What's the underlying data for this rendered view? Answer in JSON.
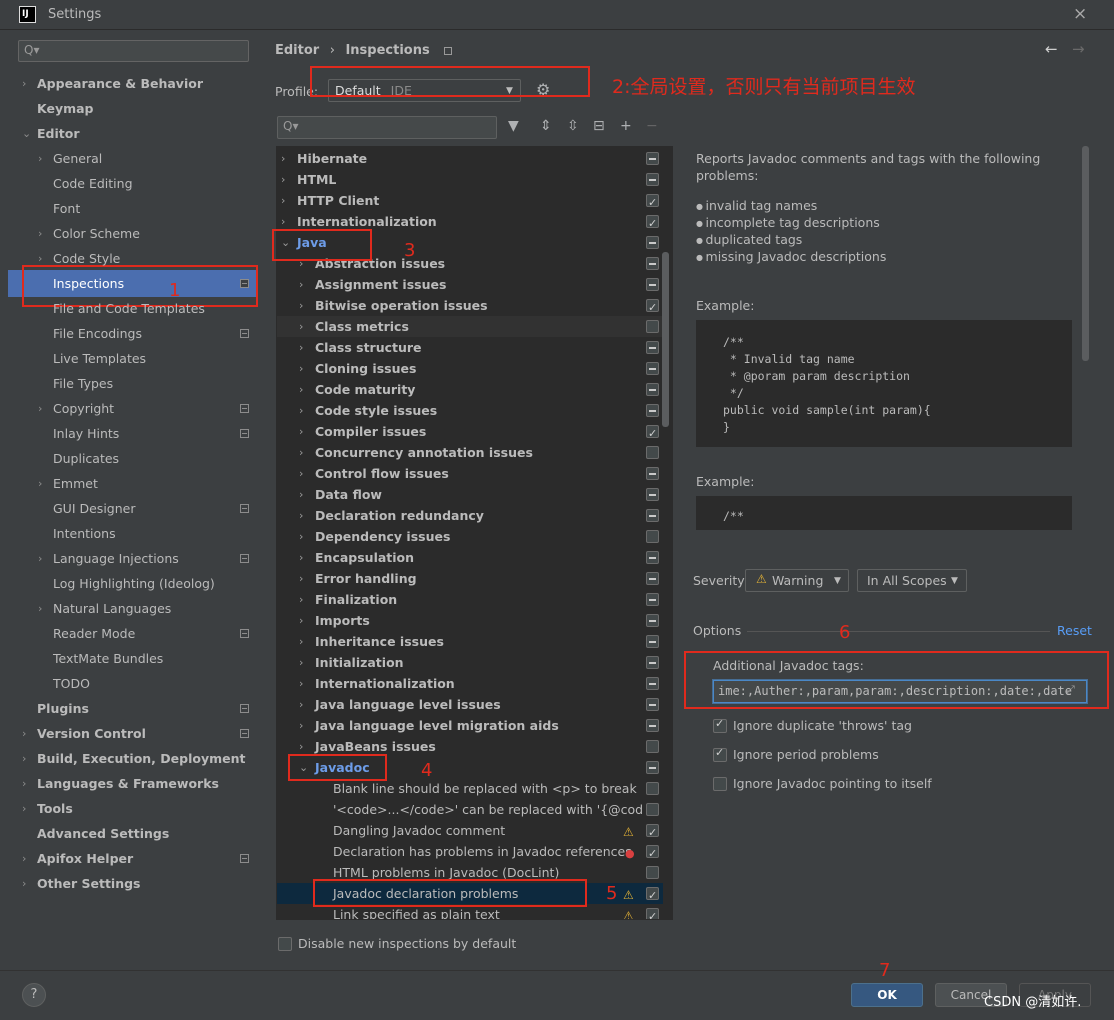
{
  "window": {
    "logo": "IJ",
    "title": "Settings",
    "close_icon": "×"
  },
  "sidebar": {
    "search_placeholder": "Q▾",
    "items": [
      {
        "label": "Appearance & Behavior",
        "bold": true,
        "arrow": "›"
      },
      {
        "label": "Keymap",
        "bold": true
      },
      {
        "label": "Editor",
        "bold": true,
        "arrow": "⌄"
      },
      {
        "label": "General",
        "arrow": "›"
      },
      {
        "label": "Code Editing"
      },
      {
        "label": "Font"
      },
      {
        "label": "Color Scheme",
        "arrow": "›"
      },
      {
        "label": "Code Style",
        "arrow": "›"
      },
      {
        "label": "Inspections",
        "selected": true,
        "square": true
      },
      {
        "label": "File and Code Templates"
      },
      {
        "label": "File Encodings",
        "square": true
      },
      {
        "label": "Live Templates"
      },
      {
        "label": "File Types"
      },
      {
        "label": "Copyright",
        "arrow": "›",
        "square": true
      },
      {
        "label": "Inlay Hints",
        "square": true
      },
      {
        "label": "Duplicates"
      },
      {
        "label": "Emmet",
        "arrow": "›"
      },
      {
        "label": "GUI Designer",
        "square": true
      },
      {
        "label": "Intentions"
      },
      {
        "label": "Language Injections",
        "arrow": "›",
        "square": true
      },
      {
        "label": "Log Highlighting (Ideolog)"
      },
      {
        "label": "Natural Languages",
        "arrow": "›"
      },
      {
        "label": "Reader Mode",
        "square": true
      },
      {
        "label": "TextMate Bundles"
      },
      {
        "label": "TODO"
      },
      {
        "label": "Plugins",
        "bold": true,
        "square": true
      },
      {
        "label": "Version Control",
        "bold": true,
        "arrow": "›",
        "square": true
      },
      {
        "label": "Build, Execution, Deployment",
        "bold": true,
        "arrow": "›"
      },
      {
        "label": "Languages & Frameworks",
        "bold": true,
        "arrow": "›"
      },
      {
        "label": "Tools",
        "bold": true,
        "arrow": "›"
      },
      {
        "label": "Advanced Settings",
        "bold": true
      },
      {
        "label": "Apifox Helper",
        "bold": true,
        "arrow": "›",
        "square": true
      },
      {
        "label": "Other Settings",
        "bold": true,
        "arrow": "›"
      }
    ]
  },
  "header": {
    "breadcrumb_editor": "Editor",
    "breadcrumb_sep": "›",
    "breadcrumb_page": "Inspections",
    "back_icon": "←",
    "forward_icon": "→"
  },
  "profile": {
    "label": "Profile:",
    "value": "Default",
    "scope": "IDE"
  },
  "toolbar": {
    "filter_placeholder": "Q▾"
  },
  "tree": [
    {
      "label": "Hibernate",
      "style": "b",
      "arrow": "›",
      "cb": "partial"
    },
    {
      "label": "HTML",
      "style": "b",
      "arrow": "›",
      "cb": "partial"
    },
    {
      "label": "HTTP Client",
      "style": "b",
      "arrow": "›",
      "cb": "checked"
    },
    {
      "label": "Internationalization",
      "style": "b",
      "arrow": "›",
      "cb": "checked"
    },
    {
      "label": "Java",
      "style": "blue",
      "arrow": "⌄",
      "cb": "partial",
      "indent": 0
    },
    {
      "label": "Abstraction issues",
      "style": "b",
      "arrow": "›",
      "cb": "partial",
      "indent": 1
    },
    {
      "label": "Assignment issues",
      "style": "b",
      "arrow": "›",
      "cb": "partial",
      "indent": 1
    },
    {
      "label": "Bitwise operation issues",
      "style": "b",
      "arrow": "›",
      "cb": "checked",
      "indent": 1
    },
    {
      "label": "Class metrics",
      "style": "b",
      "arrow": "›",
      "cb": "empty",
      "indent": 1,
      "hl": true
    },
    {
      "label": "Class structure",
      "style": "b",
      "arrow": "›",
      "cb": "partial",
      "indent": 1
    },
    {
      "label": "Cloning issues",
      "style": "b",
      "arrow": "›",
      "cb": "partial",
      "indent": 1
    },
    {
      "label": "Code maturity",
      "style": "b",
      "arrow": "›",
      "cb": "partial",
      "indent": 1
    },
    {
      "label": "Code style issues",
      "style": "b",
      "arrow": "›",
      "cb": "partial",
      "indent": 1
    },
    {
      "label": "Compiler issues",
      "style": "b",
      "arrow": "›",
      "cb": "checked",
      "indent": 1
    },
    {
      "label": "Concurrency annotation issues",
      "style": "b",
      "arrow": "›",
      "cb": "empty",
      "indent": 1
    },
    {
      "label": "Control flow issues",
      "style": "b",
      "arrow": "›",
      "cb": "partial",
      "indent": 1
    },
    {
      "label": "Data flow",
      "style": "b",
      "arrow": "›",
      "cb": "partial",
      "indent": 1
    },
    {
      "label": "Declaration redundancy",
      "style": "b",
      "arrow": "›",
      "cb": "partial",
      "indent": 1
    },
    {
      "label": "Dependency issues",
      "style": "b",
      "arrow": "›",
      "cb": "empty",
      "indent": 1
    },
    {
      "label": "Encapsulation",
      "style": "b",
      "arrow": "›",
      "cb": "partial",
      "indent": 1
    },
    {
      "label": "Error handling",
      "style": "b",
      "arrow": "›",
      "cb": "partial",
      "indent": 1
    },
    {
      "label": "Finalization",
      "style": "b",
      "arrow": "›",
      "cb": "partial",
      "indent": 1
    },
    {
      "label": "Imports",
      "style": "b",
      "arrow": "›",
      "cb": "partial",
      "indent": 1
    },
    {
      "label": "Inheritance issues",
      "style": "b",
      "arrow": "›",
      "cb": "partial",
      "indent": 1
    },
    {
      "label": "Initialization",
      "style": "b",
      "arrow": "›",
      "cb": "partial",
      "indent": 1
    },
    {
      "label": "Internationalization",
      "style": "b",
      "arrow": "›",
      "cb": "partial",
      "indent": 1
    },
    {
      "label": "Java language level issues",
      "style": "b",
      "arrow": "›",
      "cb": "partial",
      "indent": 1
    },
    {
      "label": "Java language level migration aids",
      "style": "b",
      "arrow": "›",
      "cb": "partial",
      "indent": 1
    },
    {
      "label": "JavaBeans issues",
      "style": "b",
      "arrow": "›",
      "cb": "empty",
      "indent": 1
    },
    {
      "label": "Javadoc",
      "style": "blue",
      "arrow": "⌄",
      "cb": "partial",
      "indent": 1
    },
    {
      "label": "Blank line should be replaced with <p> to break",
      "style": "n",
      "cb": "empty",
      "indent": 2
    },
    {
      "label": "'<code>...</code>' can be replaced with '{@cod",
      "style": "n",
      "cb": "empty",
      "indent": 2
    },
    {
      "label": "Dangling Javadoc comment",
      "style": "n",
      "cb": "checked",
      "indent": 2,
      "mark": "warn"
    },
    {
      "label": "Declaration has problems in Javadoc references",
      "style": "n",
      "cb": "checked",
      "indent": 2,
      "mark": "err"
    },
    {
      "label": "HTML problems in Javadoc (DocLint)",
      "style": "n",
      "cb": "empty",
      "indent": 2
    },
    {
      "label": "Javadoc declaration problems",
      "style": "n",
      "cb": "checked",
      "indent": 2,
      "mark": "warn",
      "selected": true
    },
    {
      "label": "Link specified as plain text",
      "style": "n",
      "cb": "checked",
      "indent": 2,
      "mark": "warn"
    }
  ],
  "description": {
    "intro_line1": "Reports Javadoc comments and tags with the following",
    "intro_line2": "problems:",
    "bullets": [
      "invalid tag names",
      "incomplete tag descriptions",
      "duplicated tags",
      "missing Javadoc descriptions"
    ],
    "example_label": "Example:",
    "code1": "/**\n * Invalid tag name\n * @poram param description\n */\npublic void sample(int param){\n}",
    "example2_label": "Example:",
    "code2": "/**"
  },
  "severity": {
    "label": "Severity:",
    "value": "Warning",
    "scope": "In All Scopes"
  },
  "options": {
    "label": "Options",
    "reset": "Reset",
    "tags_label": "Additional Javadoc tags:",
    "tags_value": "ime:,Auther:,param,param:,description:,date:,date",
    "checkboxes": [
      {
        "label": "Ignore duplicate 'throws' tag",
        "checked": true
      },
      {
        "label": "Ignore period problems",
        "checked": true
      },
      {
        "label": "Ignore Javadoc pointing to itself",
        "checked": false
      }
    ]
  },
  "disable_new": {
    "label": "Disable new inspections by default",
    "checked": false
  },
  "footer": {
    "help": "?",
    "ok": "OK",
    "cancel": "Cancel",
    "apply": "Apply",
    "watermark": "CSDN @清如许."
  },
  "annotations": {
    "n1": "1",
    "n2": "2:全局设置，否则只有当前项目生效",
    "n3": "3",
    "n4": "4",
    "n5": "5",
    "n6": "6",
    "n7": "7"
  },
  "colors": {
    "accent": "#4b6eaf",
    "annotation": "#e02a1d",
    "link": "#589df6",
    "warning": "#e0b036"
  }
}
